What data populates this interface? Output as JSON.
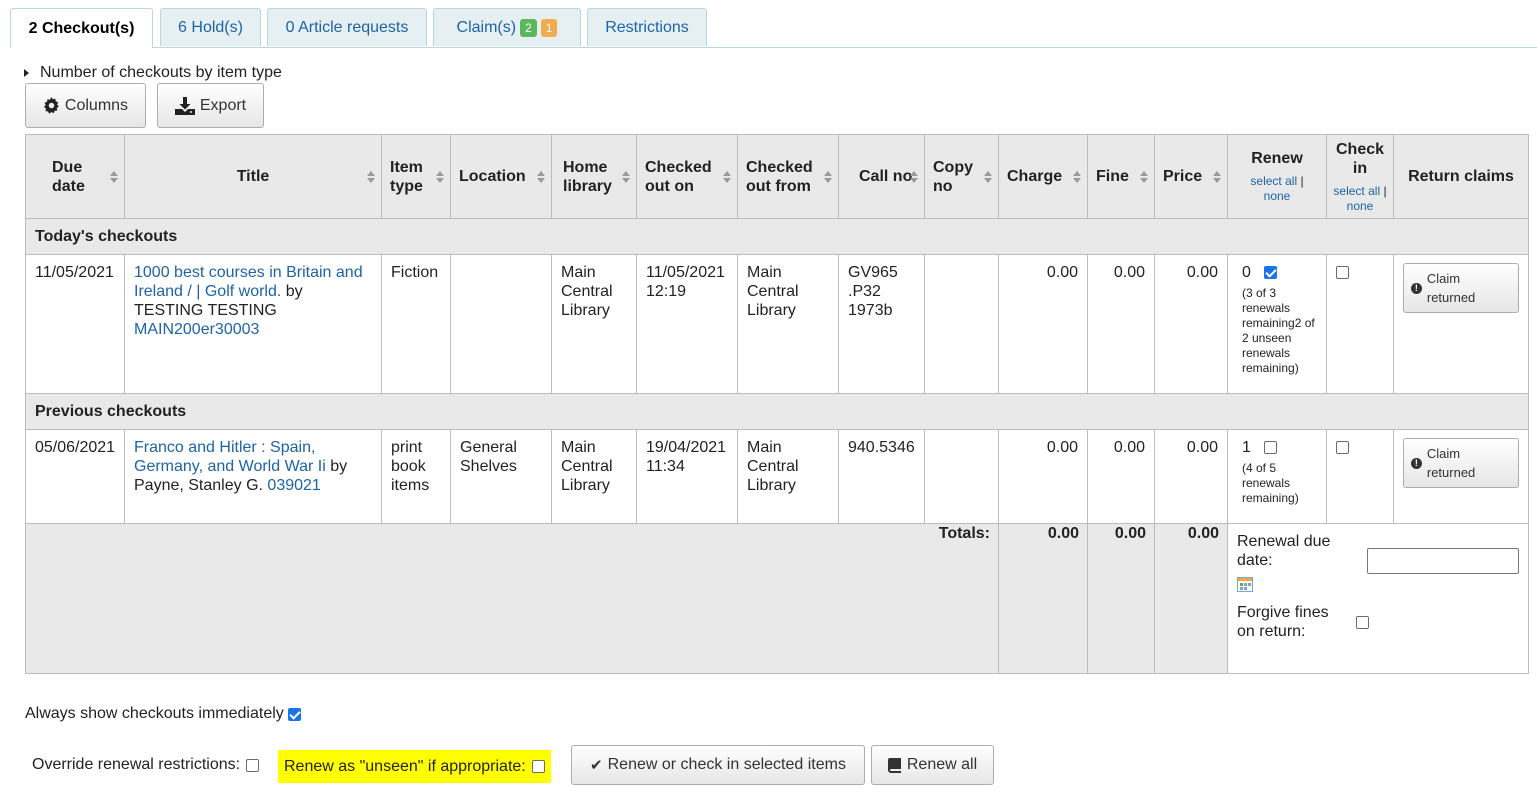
{
  "tabs": [
    {
      "label": "2 Checkout(s)"
    },
    {
      "label": "6 Hold(s)"
    },
    {
      "label": "0 Article requests"
    },
    {
      "label": "Claim(s)",
      "badges": [
        "2",
        "1"
      ]
    },
    {
      "label": "Restrictions"
    }
  ],
  "summary_toggle": "Number of checkouts by item type",
  "toolbar": {
    "columns": "Columns",
    "export": "Export"
  },
  "table": {
    "headers": {
      "due_date": "Due date",
      "title": "Title",
      "item_type": "Item type",
      "location": "Location",
      "home_library": "Home library",
      "checked_out_on": "Checked out on",
      "checked_out_from": "Checked out from",
      "call_no": "Call no",
      "copy_no": "Copy no",
      "charge": "Charge",
      "fine": "Fine",
      "price": "Price",
      "renew": "Renew",
      "check_in": "Check in",
      "return_claims": "Return claims"
    },
    "select_all": "select all",
    "sep": "|",
    "none": "none",
    "groups": {
      "today": "Today's checkouts",
      "previous": "Previous checkouts"
    },
    "rows": [
      {
        "due_date": "11/05/2021",
        "title": "1000 best courses in Britain and Ireland / | Golf world.",
        "by": "by",
        "author": "TESTING TESTING",
        "barcode": "MAIN200er30003",
        "item_type": "Fiction",
        "location": "",
        "home_library": "Main Central Library",
        "checked_out_on": "11/05/2021 12:19",
        "checked_out_from": "Main Central Library",
        "call_no": "GV965 .P32 1973b",
        "copy_no": "",
        "charge": "0.00",
        "fine": "0.00",
        "price": "0.00",
        "renew_count": "0",
        "renew_checked": true,
        "renew_note": "(3 of 3 renewals remaining2 of 2 unseen renewals remaining)",
        "checkin_checked": false,
        "claim_label": "Claim returned"
      },
      {
        "due_date": "05/06/2021",
        "title": "Franco and Hitler : Spain, Germany, and World War Ii",
        "by": "by",
        "author": "Payne, Stanley G.",
        "barcode": "039021",
        "item_type": "print book items",
        "location": "General Shelves",
        "home_library": "Main Central Library",
        "checked_out_on": "19/04/2021 11:34",
        "checked_out_from": "Main Central Library",
        "call_no": "940.5346",
        "copy_no": "",
        "charge": "0.00",
        "fine": "0.00",
        "price": "0.00",
        "renew_count": "1",
        "renew_checked": false,
        "renew_note": "(4 of 5 renewals remaining)",
        "checkin_checked": false,
        "claim_label": "Claim returned"
      }
    ],
    "totals": {
      "label": "Totals:",
      "charge": "0.00",
      "fine": "0.00",
      "price": "0.00"
    },
    "renewal_due_date_label": "Renewal due date:",
    "renewal_due_date_value": "",
    "forgive_fines_label": "Forgive fines on return:"
  },
  "always_show": {
    "label": "Always show checkouts immediately",
    "checked": true
  },
  "override_label": "Override renewal restrictions:",
  "unseen_label": "Renew as \"unseen\" if appropriate:",
  "renew_checkin_button": "Renew or check in selected items",
  "renew_all_button": "Renew all",
  "colors": {
    "link": "#1d63a6",
    "tab_bg": "#e6f0f2",
    "header_bg": "#e9e9e9",
    "highlight": "#ffff00",
    "badge_green": "#5cb85c",
    "badge_orange": "#f0ad4e"
  }
}
